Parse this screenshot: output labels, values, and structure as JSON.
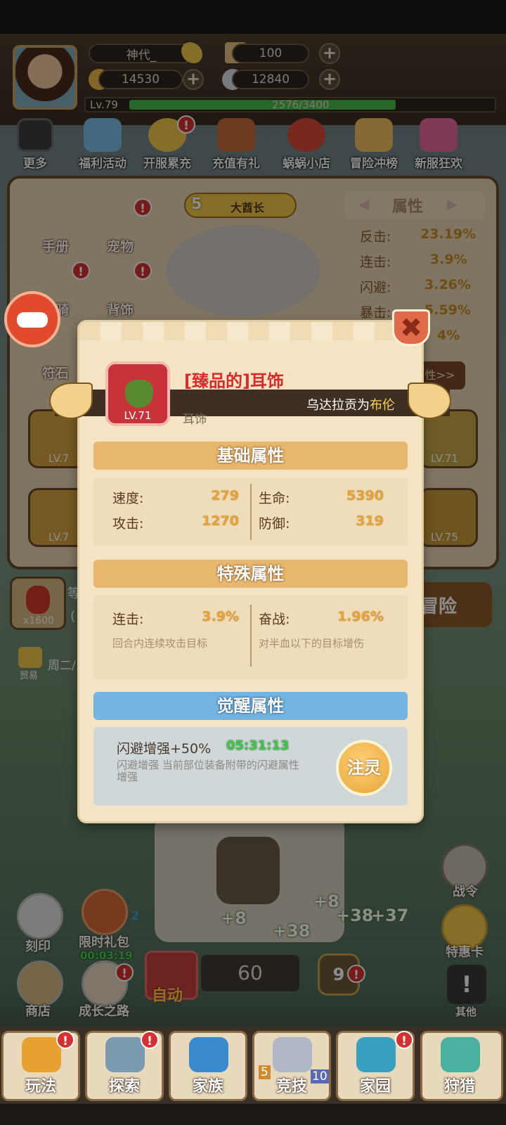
{
  "player": {
    "name": "神代_",
    "tickets": "100",
    "coins": "14530",
    "shells": "12840",
    "level": "Lv.79",
    "exp": "2576/3400",
    "exp_progress": 0.758
  },
  "activities": [
    {
      "label": "更多",
      "icon": "grid-icon",
      "badge": false
    },
    {
      "label": "福利活动",
      "icon": "gift-icon",
      "badge": false
    },
    {
      "label": "开服累充",
      "icon": "coin-icon",
      "badge": true
    },
    {
      "label": "充值有礼",
      "icon": "chest-icon",
      "badge": false
    },
    {
      "label": "蜗蜗小店",
      "icon": "shop-icon",
      "badge": false
    },
    {
      "label": "冒险冲榜",
      "icon": "podium-icon",
      "badge": false
    },
    {
      "label": "新服狂欢",
      "icon": "party-icon",
      "badge": false
    }
  ],
  "background_panel": {
    "menu": [
      "手册",
      "宠物",
      "坐骑",
      "背饰",
      "符石"
    ],
    "hero_rank_num": "5",
    "hero_rank": "大酋长",
    "attr_title": "属性",
    "stats": [
      {
        "label": "反击:",
        "value": "23.19%"
      },
      {
        "label": "连击:",
        "value": "3.9%"
      },
      {
        "label": "闪避:",
        "value": "3.26%"
      },
      {
        "label": "暴击:",
        "value": "5.59%"
      },
      {
        "label": "",
        "value": "4%"
      }
    ],
    "more_attr": "性>>",
    "slot_levels": [
      "LV.7",
      "LV.71",
      "LV.7",
      "LV.75"
    ]
  },
  "modal": {
    "item_name": "[臻品的]耳饰",
    "item_level": "LV.71",
    "item_type": "耳饰",
    "ribbon_prefix": "乌达拉贡为",
    "ribbon_highlight": "布伦",
    "close_icon": "✖",
    "sections": {
      "base_title": "基础属性",
      "special_title": "特殊属性",
      "awaken_title": "觉醒属性"
    },
    "base_stats": [
      {
        "label": "速度:",
        "value": "279"
      },
      {
        "label": "生命:",
        "value": "5390"
      },
      {
        "label": "攻击:",
        "value": "1270"
      },
      {
        "label": "防御:",
        "value": "319"
      }
    ],
    "special_stats": [
      {
        "label": "连击:",
        "value": "3.9%",
        "desc": "回合内连续攻击目标"
      },
      {
        "label": "奋战:",
        "value": "1.96%",
        "desc": "对半血以下的目标增伤"
      }
    ],
    "awaken": {
      "name": "闪避增强+50%",
      "timer": "05:31:13",
      "desc": "闪避增强 当前部位装备附带的闪避属性增强",
      "button": "注灵"
    }
  },
  "left_side": {
    "chili_count": "x1600",
    "trade_label": "贸易",
    "schedule": "周二/",
    "side_text": "等",
    "paren": "("
  },
  "adventure_label": "冒险",
  "lower": {
    "engrave": "刻印",
    "limited_pack": "限时礼包",
    "limited_timer": "00:03:19",
    "shop": "商店",
    "growth": "成长之路",
    "auto": "自动",
    "stage": "60",
    "level_badge": "9",
    "battle_pass": "战令",
    "special_card": "特惠卡",
    "other": "其他",
    "floats": [
      "+8",
      "+38",
      "+8",
      "+38",
      "+37"
    ],
    "blue_count": "2"
  },
  "nav": [
    {
      "label": "玩法",
      "badge": true,
      "icon": "mask-icon"
    },
    {
      "label": "探索",
      "badge": true,
      "icon": "backpack-icon"
    },
    {
      "label": "家族",
      "badge": false,
      "icon": "shield-icon"
    },
    {
      "label": "竞技",
      "badge": false,
      "icon": "sword-icon",
      "left_num": "5",
      "right_num": "10"
    },
    {
      "label": "家园",
      "badge": true,
      "icon": "house-icon"
    },
    {
      "label": "狩猎",
      "badge": false,
      "icon": "dragon-icon"
    }
  ]
}
